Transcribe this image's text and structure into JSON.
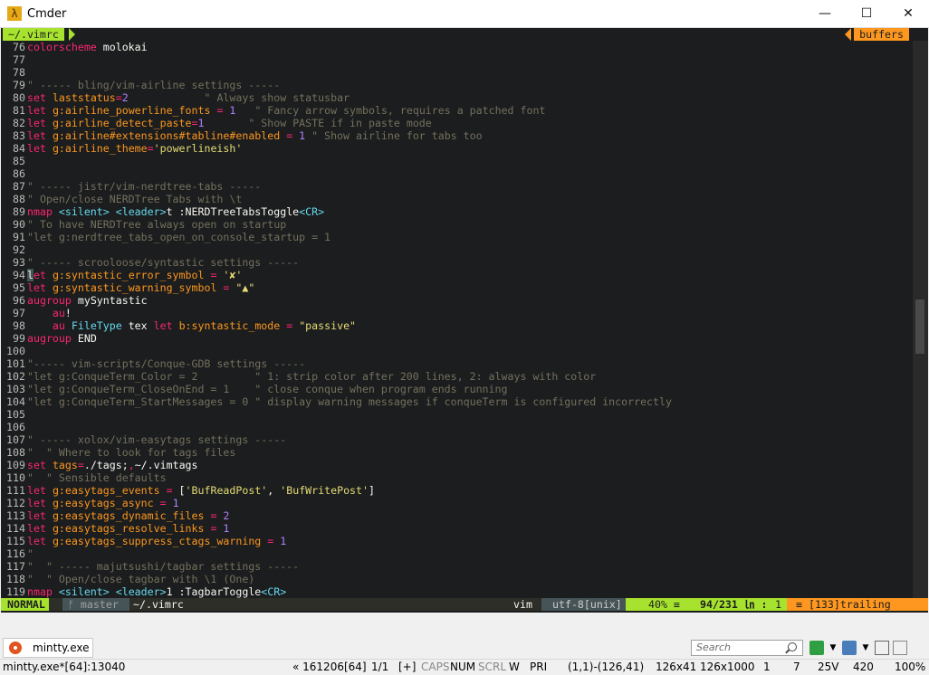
{
  "window": {
    "title": "Cmder",
    "app_icon": "λ"
  },
  "titlebar_buttons": {
    "minimize": "—",
    "maximize": "☐",
    "close": "✕"
  },
  "tabline": {
    "left": "~/.vimrc",
    "right": "buffers"
  },
  "lines": [
    {
      "n": "76",
      "segs": [
        [
          "kw",
          "colorscheme"
        ],
        [
          "txt",
          " molokai"
        ]
      ]
    },
    {
      "n": "77",
      "segs": []
    },
    {
      "n": "78",
      "segs": []
    },
    {
      "n": "79",
      "segs": [
        [
          "cmt",
          "\" ----- bling/vim-airline settings -----"
        ]
      ]
    },
    {
      "n": "80",
      "segs": [
        [
          "kw",
          "set"
        ],
        [
          "txt",
          " "
        ],
        [
          "var",
          "laststatus"
        ],
        [
          "op",
          "="
        ],
        [
          "num",
          "2"
        ],
        [
          "txt",
          "            "
        ],
        [
          "cmt",
          "\" Always show statusbar"
        ]
      ]
    },
    {
      "n": "81",
      "segs": [
        [
          "kw",
          "let"
        ],
        [
          "txt",
          " "
        ],
        [
          "var",
          "g:airline_powerline_fonts"
        ],
        [
          "txt",
          " "
        ],
        [
          "op",
          "="
        ],
        [
          "txt",
          " "
        ],
        [
          "num",
          "1"
        ],
        [
          "txt",
          "   "
        ],
        [
          "cmt",
          "\" Fancy arrow symbols, requires a patched font"
        ]
      ]
    },
    {
      "n": "82",
      "segs": [
        [
          "kw",
          "let"
        ],
        [
          "txt",
          " "
        ],
        [
          "var",
          "g:airline_detect_paste"
        ],
        [
          "op",
          "="
        ],
        [
          "num",
          "1"
        ],
        [
          "txt",
          "       "
        ],
        [
          "cmt",
          "\" Show PASTE if in paste mode"
        ]
      ]
    },
    {
      "n": "83",
      "segs": [
        [
          "kw",
          "let"
        ],
        [
          "txt",
          " "
        ],
        [
          "var",
          "g:airline#extensions#tabline#enabled"
        ],
        [
          "txt",
          " "
        ],
        [
          "op",
          "="
        ],
        [
          "txt",
          " "
        ],
        [
          "num",
          "1"
        ],
        [
          "txt",
          " "
        ],
        [
          "cmt",
          "\" Show airline for tabs too"
        ]
      ]
    },
    {
      "n": "84",
      "segs": [
        [
          "kw",
          "let"
        ],
        [
          "txt",
          " "
        ],
        [
          "var",
          "g:airline_theme"
        ],
        [
          "op",
          "="
        ],
        [
          "str",
          "'powerlineish'"
        ]
      ]
    },
    {
      "n": "85",
      "segs": []
    },
    {
      "n": "86",
      "segs": []
    },
    {
      "n": "87",
      "segs": [
        [
          "cmt",
          "\" ----- jistr/vim-nerdtree-tabs -----"
        ]
      ]
    },
    {
      "n": "88",
      "segs": [
        [
          "cmt",
          "\" Open/close NERDTree Tabs with \\t"
        ]
      ]
    },
    {
      "n": "89",
      "segs": [
        [
          "kw",
          "nmap"
        ],
        [
          "txt",
          " "
        ],
        [
          "fn",
          "<silent>"
        ],
        [
          "txt",
          " "
        ],
        [
          "fn",
          "<leader>"
        ],
        [
          "txt",
          "t :NERDTreeTabsToggle"
        ],
        [
          "fn",
          "<CR>"
        ]
      ]
    },
    {
      "n": "90",
      "segs": [
        [
          "cmt",
          "\" To have NERDTree always open on startup"
        ]
      ]
    },
    {
      "n": "91",
      "segs": [
        [
          "cmt",
          "\"let g:nerdtree_tabs_open_on_console_startup = 1"
        ]
      ]
    },
    {
      "n": "92",
      "segs": []
    },
    {
      "n": "93",
      "segs": [
        [
          "cmt",
          "\" ----- scrooloose/syntastic settings -----"
        ]
      ]
    },
    {
      "n": "94",
      "segs": [
        [
          "cur",
          "l"
        ],
        [
          "kw",
          "et"
        ],
        [
          "txt",
          " "
        ],
        [
          "var",
          "g:syntastic_error_symbol"
        ],
        [
          "txt",
          " "
        ],
        [
          "op",
          "="
        ],
        [
          "txt",
          " "
        ],
        [
          "str",
          "'✘'"
        ]
      ]
    },
    {
      "n": "95",
      "segs": [
        [
          "kw",
          "let"
        ],
        [
          "txt",
          " "
        ],
        [
          "var",
          "g:syntastic_warning_symbol"
        ],
        [
          "txt",
          " "
        ],
        [
          "op",
          "="
        ],
        [
          "txt",
          " "
        ],
        [
          "str",
          "\"▲\""
        ]
      ]
    },
    {
      "n": "96",
      "segs": [
        [
          "kw",
          "augroup"
        ],
        [
          "txt",
          " mySyntastic"
        ]
      ]
    },
    {
      "n": "97",
      "segs": [
        [
          "txt",
          "    "
        ],
        [
          "kw",
          "au"
        ],
        [
          "txt",
          "!"
        ]
      ]
    },
    {
      "n": "98",
      "segs": [
        [
          "txt",
          "    "
        ],
        [
          "kw",
          "au"
        ],
        [
          "txt",
          " "
        ],
        [
          "fn",
          "FileType"
        ],
        [
          "txt",
          " tex "
        ],
        [
          "kw",
          "let"
        ],
        [
          "txt",
          " "
        ],
        [
          "var",
          "b:syntastic_mode"
        ],
        [
          "txt",
          " "
        ],
        [
          "op",
          "="
        ],
        [
          "txt",
          " "
        ],
        [
          "str",
          "\"passive\""
        ]
      ]
    },
    {
      "n": "99",
      "segs": [
        [
          "kw",
          "augroup"
        ],
        [
          "txt",
          " END"
        ]
      ]
    },
    {
      "n": "100",
      "segs": []
    },
    {
      "n": "101",
      "segs": [
        [
          "cmt",
          "\"----- vim-scripts/Conque-GDB settings -----"
        ]
      ]
    },
    {
      "n": "102",
      "segs": [
        [
          "cmt",
          "\"let g:ConqueTerm_Color = 2         \" 1: strip color after 200 lines, 2: always with color"
        ]
      ]
    },
    {
      "n": "103",
      "segs": [
        [
          "cmt",
          "\"let g:ConqueTerm_CloseOnEnd = 1    \" close conque when program ends running"
        ]
      ]
    },
    {
      "n": "104",
      "segs": [
        [
          "cmt",
          "\"let g:ConqueTerm_StartMessages = 0 \" display warning messages if conqueTerm is configured incorrectly"
        ]
      ]
    },
    {
      "n": "105",
      "segs": []
    },
    {
      "n": "106",
      "segs": []
    },
    {
      "n": "107",
      "segs": [
        [
          "cmt",
          "\" ----- xolox/vim-easytags settings -----"
        ]
      ]
    },
    {
      "n": "108",
      "segs": [
        [
          "cmt",
          "\"  \" Where to look for tags files"
        ]
      ]
    },
    {
      "n": "109",
      "segs": [
        [
          "kw",
          "set"
        ],
        [
          "txt",
          " "
        ],
        [
          "var",
          "tags"
        ],
        [
          "op",
          "="
        ],
        [
          "txt",
          "./tags;"
        ],
        [
          "op",
          ","
        ],
        [
          "txt",
          "~/.vimtags"
        ]
      ]
    },
    {
      "n": "110",
      "segs": [
        [
          "cmt",
          "\"  \" Sensible defaults"
        ]
      ]
    },
    {
      "n": "111",
      "segs": [
        [
          "kw",
          "let"
        ],
        [
          "txt",
          " "
        ],
        [
          "var",
          "g:easytags_events"
        ],
        [
          "txt",
          " "
        ],
        [
          "op",
          "="
        ],
        [
          "txt",
          " ["
        ],
        [
          "str",
          "'BufReadPost'"
        ],
        [
          "txt",
          ", "
        ],
        [
          "str",
          "'BufWritePost'"
        ],
        [
          "txt",
          "]"
        ]
      ]
    },
    {
      "n": "112",
      "segs": [
        [
          "kw",
          "let"
        ],
        [
          "txt",
          " "
        ],
        [
          "var",
          "g:easytags_async"
        ],
        [
          "txt",
          " "
        ],
        [
          "op",
          "="
        ],
        [
          "txt",
          " "
        ],
        [
          "num",
          "1"
        ]
      ]
    },
    {
      "n": "113",
      "segs": [
        [
          "kw",
          "let"
        ],
        [
          "txt",
          " "
        ],
        [
          "var",
          "g:easytags_dynamic_files"
        ],
        [
          "txt",
          " "
        ],
        [
          "op",
          "="
        ],
        [
          "txt",
          " "
        ],
        [
          "num",
          "2"
        ]
      ]
    },
    {
      "n": "114",
      "segs": [
        [
          "kw",
          "let"
        ],
        [
          "txt",
          " "
        ],
        [
          "var",
          "g:easytags_resolve_links"
        ],
        [
          "txt",
          " "
        ],
        [
          "op",
          "="
        ],
        [
          "txt",
          " "
        ],
        [
          "num",
          "1"
        ]
      ]
    },
    {
      "n": "115",
      "segs": [
        [
          "kw",
          "let"
        ],
        [
          "txt",
          " "
        ],
        [
          "var",
          "g:easytags_suppress_ctags_warning"
        ],
        [
          "txt",
          " "
        ],
        [
          "op",
          "="
        ],
        [
          "txt",
          " "
        ],
        [
          "num",
          "1"
        ]
      ]
    },
    {
      "n": "116",
      "segs": [
        [
          "cmt",
          "\""
        ]
      ]
    },
    {
      "n": "117",
      "segs": [
        [
          "cmt",
          "\"  \" ----- majutsushi/tagbar settings -----"
        ]
      ]
    },
    {
      "n": "118",
      "segs": [
        [
          "cmt",
          "\"  \" Open/close tagbar with \\1 (One)"
        ]
      ]
    },
    {
      "n": "119",
      "segs": [
        [
          "kw",
          "nmap"
        ],
        [
          "txt",
          " "
        ],
        [
          "fn",
          "<silent>"
        ],
        [
          "txt",
          " "
        ],
        [
          "fn",
          "<leader>"
        ],
        [
          "txt",
          "1 :TagbarToggle"
        ],
        [
          "fn",
          "<CR>"
        ]
      ]
    }
  ],
  "statusline": {
    "mode": "NORMAL",
    "branch": "ᚠ master",
    "filename": "~/.vimrc",
    "filetype": "vim",
    "encoding": "utf-8[unix]",
    "percent": "40% ≡",
    "lines": "94/231",
    "ln_symbol": "㏑ :",
    "col": "1",
    "warning": "≡ [133]trailing"
  },
  "colors": {
    "background": "#1b1d1e",
    "keyword": "#f92672",
    "variable": "#fd971f",
    "number": "#ae81ff",
    "string": "#e6db74",
    "comment": "#75715e",
    "function": "#66d9ef",
    "mode_bg": "#a6e22e"
  },
  "bottom": {
    "tab_label": "mintty.exe",
    "search_placeholder": "Search"
  },
  "statusbar": {
    "process": "mintty.exe*[64]:13040",
    "build": "« 161206[64]",
    "page": "1/1",
    "plus": "[+]",
    "caps": "CAPS",
    "num": "NUM",
    "scrl": "SCRL",
    "w": "W",
    "pri": "PRI",
    "coords": "(1,1)-(126,41)",
    "size1": "126x41",
    "size2": "126x1000",
    "v1": "1",
    "v2": "7",
    "v3": "25V",
    "v4": "420",
    "zoom": "100%"
  }
}
